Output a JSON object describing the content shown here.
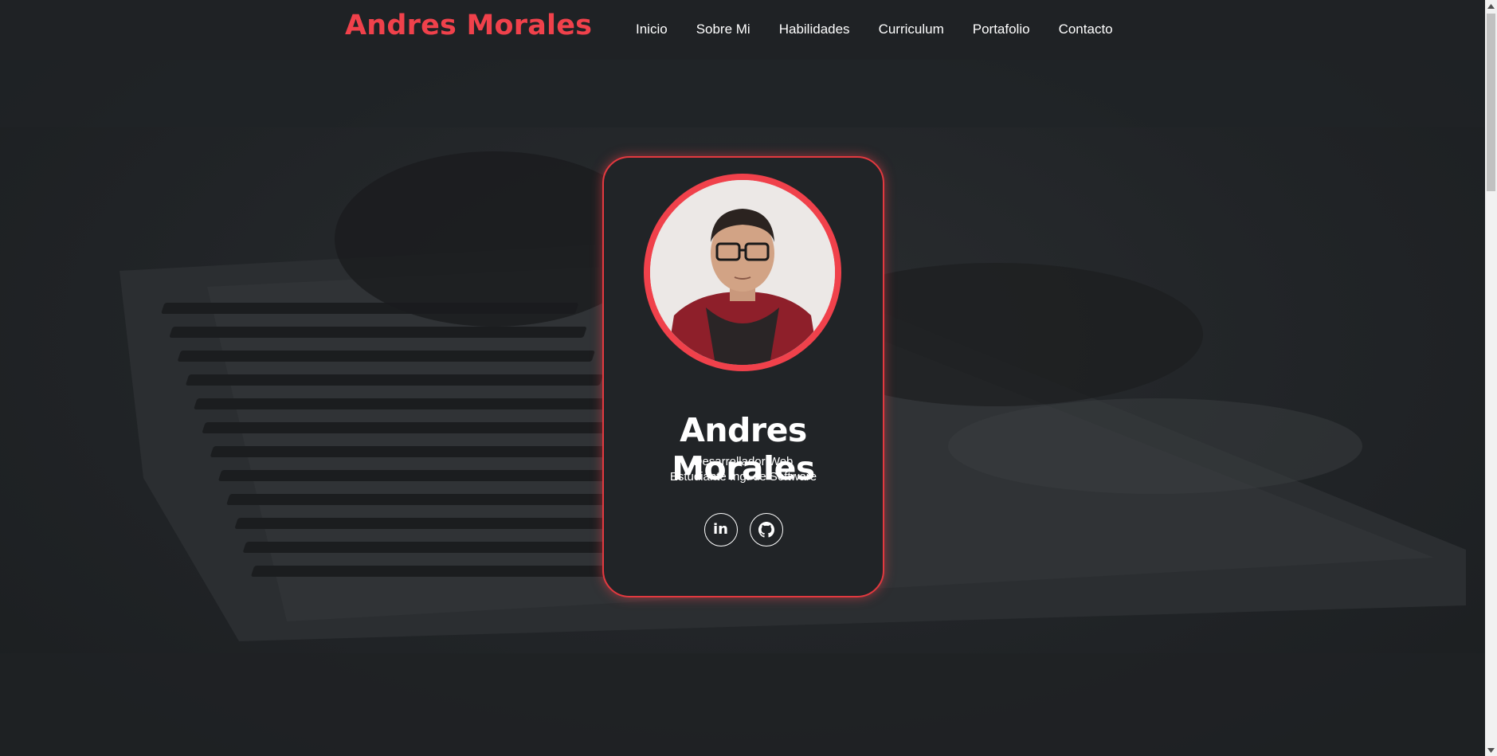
{
  "header": {
    "brand": "Andres Morales",
    "nav": [
      "Inicio",
      "Sobre Mi",
      "Habilidades",
      "Curriculum",
      "Portafolio",
      "Contacto"
    ]
  },
  "profile": {
    "name": "Andres Morales",
    "role_line1": "Desarrollador Web",
    "role_line2": "Estudiante Ing. de Software",
    "socials": [
      {
        "icon": "linkedin-icon",
        "label": "in"
      },
      {
        "icon": "github-icon"
      }
    ]
  },
  "colors": {
    "accent": "#f0414b",
    "background": "#212427",
    "text": "#ffffff"
  }
}
